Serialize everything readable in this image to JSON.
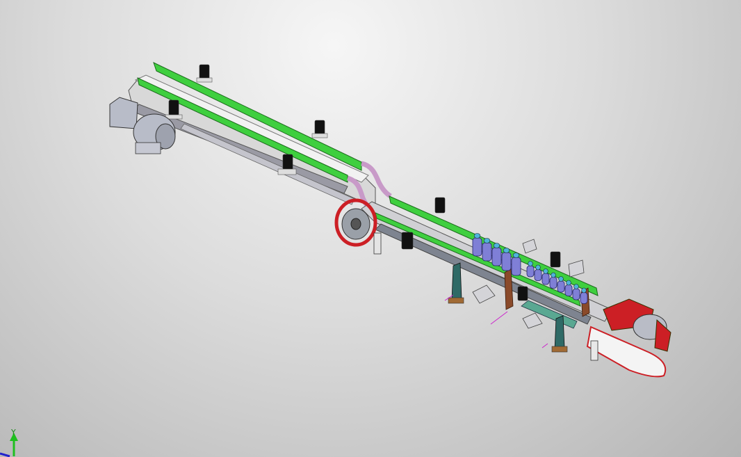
{
  "view": {
    "background_top": "#f4f4f4",
    "background_bottom": "#b6b6b6"
  },
  "model": {
    "guide_rail_color": "#3fcf3f",
    "transition_rail_color": "#c89ac8",
    "belt_color": "#e8e8e8",
    "motor_left_color": "#b8bcc8",
    "motor_right_color": "#cc1f25",
    "bottle_color": "#7f7fd6",
    "bottle_count_rear": 5,
    "bottle_count_front": 8
  },
  "triad": {
    "y_label": "Y",
    "y_color": "#1fbf1f",
    "x_color": "#2222cc"
  }
}
